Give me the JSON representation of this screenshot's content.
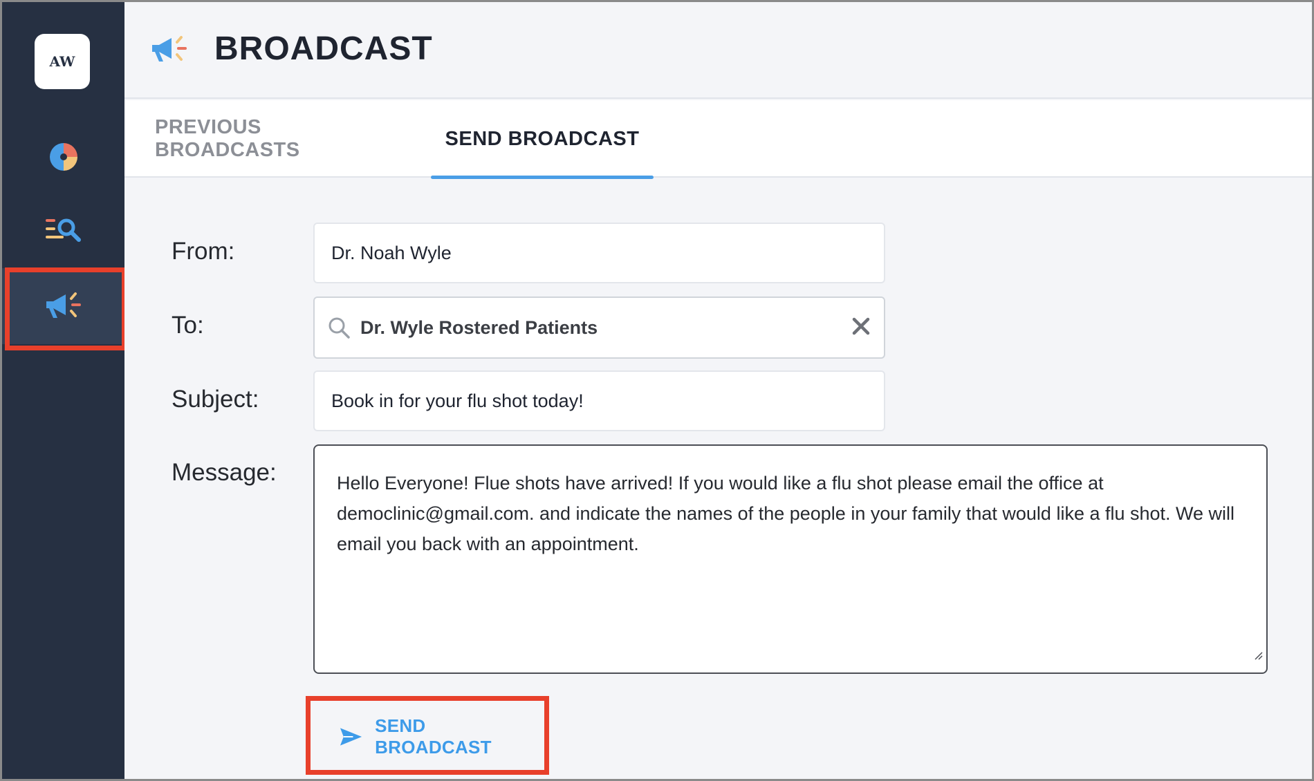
{
  "app": {
    "logo_text": "AW",
    "page_title": "BROADCAST"
  },
  "sidebar": {
    "items": [
      {
        "name": "dashboard",
        "icon": "pie-chart-icon"
      },
      {
        "name": "search",
        "icon": "list-search-icon"
      },
      {
        "name": "broadcast",
        "icon": "megaphone-icon",
        "active": true
      }
    ]
  },
  "tabs": [
    {
      "label": "PREVIOUS BROADCASTS",
      "active": false
    },
    {
      "label": "SEND BROADCAST",
      "active": true
    }
  ],
  "form": {
    "from_label": "From:",
    "from_value": "Dr. Noah Wyle",
    "to_label": "To:",
    "to_value": "Dr. Wyle Rostered Patients",
    "subject_label": "Subject:",
    "subject_value": "Book in for your flu shot today!",
    "message_label": "Message:",
    "message_value": "Hello Everyone! Flue shots have arrived! If you would like a flu shot please email the office at democlinic@gmail.com. and indicate the names of the people in your family that would like a flu shot. We will email you back with an appointment."
  },
  "actions": {
    "send_label": "SEND BROADCAST"
  },
  "colors": {
    "sidebar_bg": "#263042",
    "accent_blue": "#4a9ee6",
    "highlight_red": "#e8402b"
  }
}
